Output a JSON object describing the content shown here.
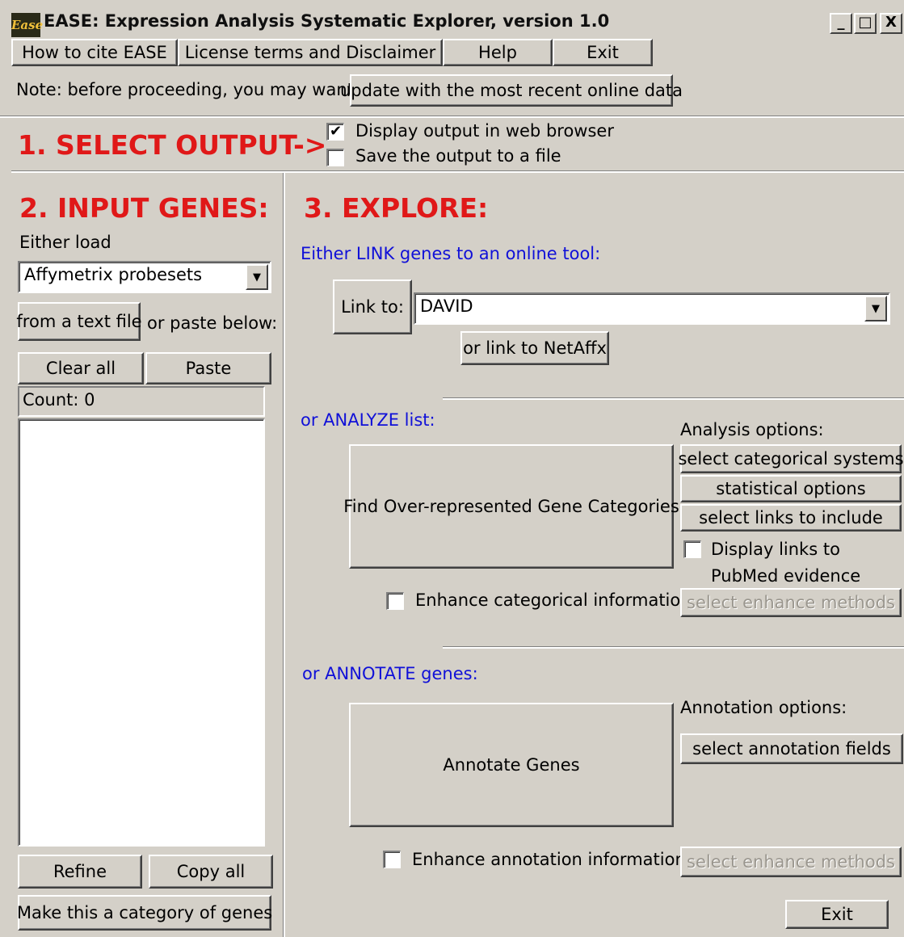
{
  "window": {
    "icon_text": "Ease",
    "title": "EASE: Expression Analysis Systematic Explorer, version 1.0",
    "minimize": "_",
    "maximize": "□",
    "close": "X"
  },
  "menu": {
    "cite": "How to cite EASE",
    "license": "License terms and Disclaimer",
    "help": "Help",
    "exit": "Exit"
  },
  "note": {
    "text": "Note: before proceeding, you may want to",
    "update_button": "update with the most recent online data"
  },
  "output": {
    "heading": "1. SELECT OUTPUT->",
    "display_browser_label": "Display output in web browser",
    "display_browser_checked": true,
    "save_file_label": "Save the output to a file",
    "save_file_checked": false
  },
  "input": {
    "heading": "2. INPUT GENES:",
    "either_load": "Either load",
    "type_select": "Affymetrix probesets",
    "from_text_file": "from a text file",
    "or_paste": "or paste below:",
    "clear_all": "Clear all",
    "paste": "Paste",
    "count": "Count: 0",
    "refine": "Refine",
    "copy_all": "Copy all",
    "make_category": "Make this a category of genes"
  },
  "explore": {
    "heading": "3. EXPLORE:",
    "link_label": "Either LINK genes to an online tool:",
    "link_to": "Link to:",
    "link_select": "DAVID",
    "link_netaffx": "or link to NetAffx",
    "analyze_label": "or ANALYZE list:",
    "analysis_options": "Analysis options:",
    "find_over": "Find Over-represented Gene Categories",
    "select_categorical": "select categorical systems",
    "statistical_options": "statistical options",
    "select_links": "select links to include",
    "display_links_1": "Display links to",
    "display_links_2": "PubMed evidence",
    "display_links_checked": false,
    "enhance_categorical": "Enhance categorical information:",
    "enhance_categorical_checked": false,
    "select_enhance_methods": "select enhance methods",
    "annotate_label": "or ANNOTATE genes:",
    "annotation_options": "Annotation options:",
    "annotate_genes": "Annotate Genes",
    "select_annotation_fields": "select annotation fields",
    "enhance_annotation": "Enhance annotation information:",
    "enhance_annotation_checked": false,
    "select_enhance_methods_2": "select enhance methods",
    "exit": "Exit"
  },
  "colors": {
    "background": "#d4d0c8",
    "heading_red": "#e01818",
    "label_blue": "#1010d8"
  }
}
